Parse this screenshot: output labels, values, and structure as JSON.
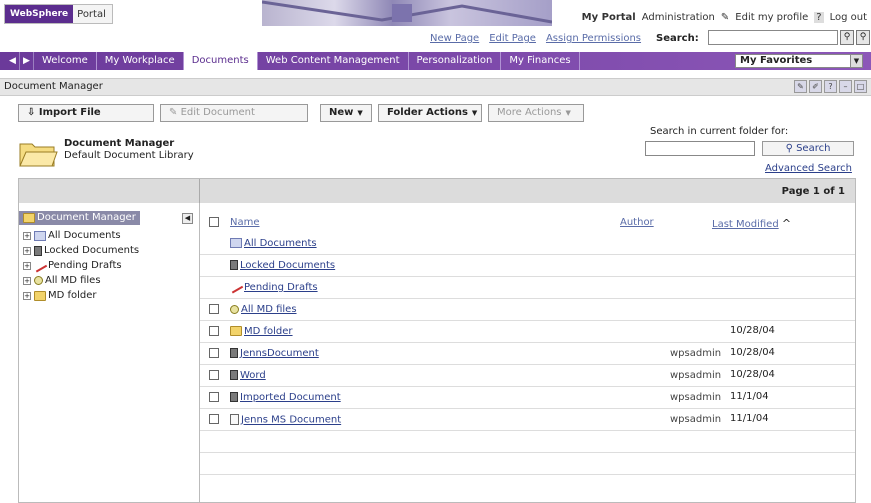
{
  "banner": {
    "logo_brand": "WebSphere",
    "logo_product": "Portal",
    "util_links": [
      "My Portal",
      "Administration",
      "Edit my profile",
      "?",
      "Log out"
    ],
    "page_links": [
      "New Page",
      "Edit Page",
      "Assign Permissions"
    ],
    "search_label": "Search:",
    "search_value": ""
  },
  "nav": {
    "tabs": [
      "Welcome",
      "My Workplace",
      "Documents",
      "Web Content Management",
      "Personalization",
      "My Finances"
    ],
    "active_tab": "Documents",
    "favorites": "My Favorites"
  },
  "portlet": {
    "title": "Document Manager",
    "icons": [
      "edit-icon",
      "configure-icon",
      "help-icon",
      "minimize-icon",
      "maximize-icon"
    ]
  },
  "toolbar": {
    "import_file": "Import File",
    "edit_document": "Edit Document",
    "new": "New",
    "folder_actions": "Folder Actions",
    "more_actions": "More Actions"
  },
  "library": {
    "title": "Document Manager",
    "subtitle": "Default Document Library",
    "search_label": "Search in current folder for:",
    "search_value": "",
    "search_button": "Search",
    "advanced_search": "Advanced Search"
  },
  "grid": {
    "page_info": "Page 1 of 1",
    "tree_root": "Document Manager",
    "tree": [
      "All Documents",
      "Locked Documents",
      "Pending Drafts",
      "All MD files",
      "MD folder"
    ],
    "columns": {
      "name": "Name",
      "author": "Author",
      "modified": "Last Modified"
    },
    "rows": [
      {
        "name": "All Documents",
        "author": "",
        "modified": "",
        "checkbox": false
      },
      {
        "name": "Locked Documents",
        "author": "",
        "modified": "",
        "checkbox": false
      },
      {
        "name": "Pending Drafts",
        "author": "",
        "modified": "",
        "checkbox": false
      },
      {
        "name": "All MD files",
        "author": "",
        "modified": "",
        "checkbox": true
      },
      {
        "name": "MD folder",
        "author": "",
        "modified": "10/28/04",
        "checkbox": true
      },
      {
        "name": "JennsDocument",
        "author": "wpsadmin",
        "modified": "10/28/04",
        "checkbox": true
      },
      {
        "name": "Word",
        "author": "wpsadmin",
        "modified": "10/28/04",
        "checkbox": true
      },
      {
        "name": "Imported Document",
        "author": "wpsadmin",
        "modified": "11/1/04",
        "checkbox": true
      },
      {
        "name": "Jenns MS Document",
        "author": "wpsadmin",
        "modified": "11/1/04",
        "checkbox": true
      }
    ]
  }
}
